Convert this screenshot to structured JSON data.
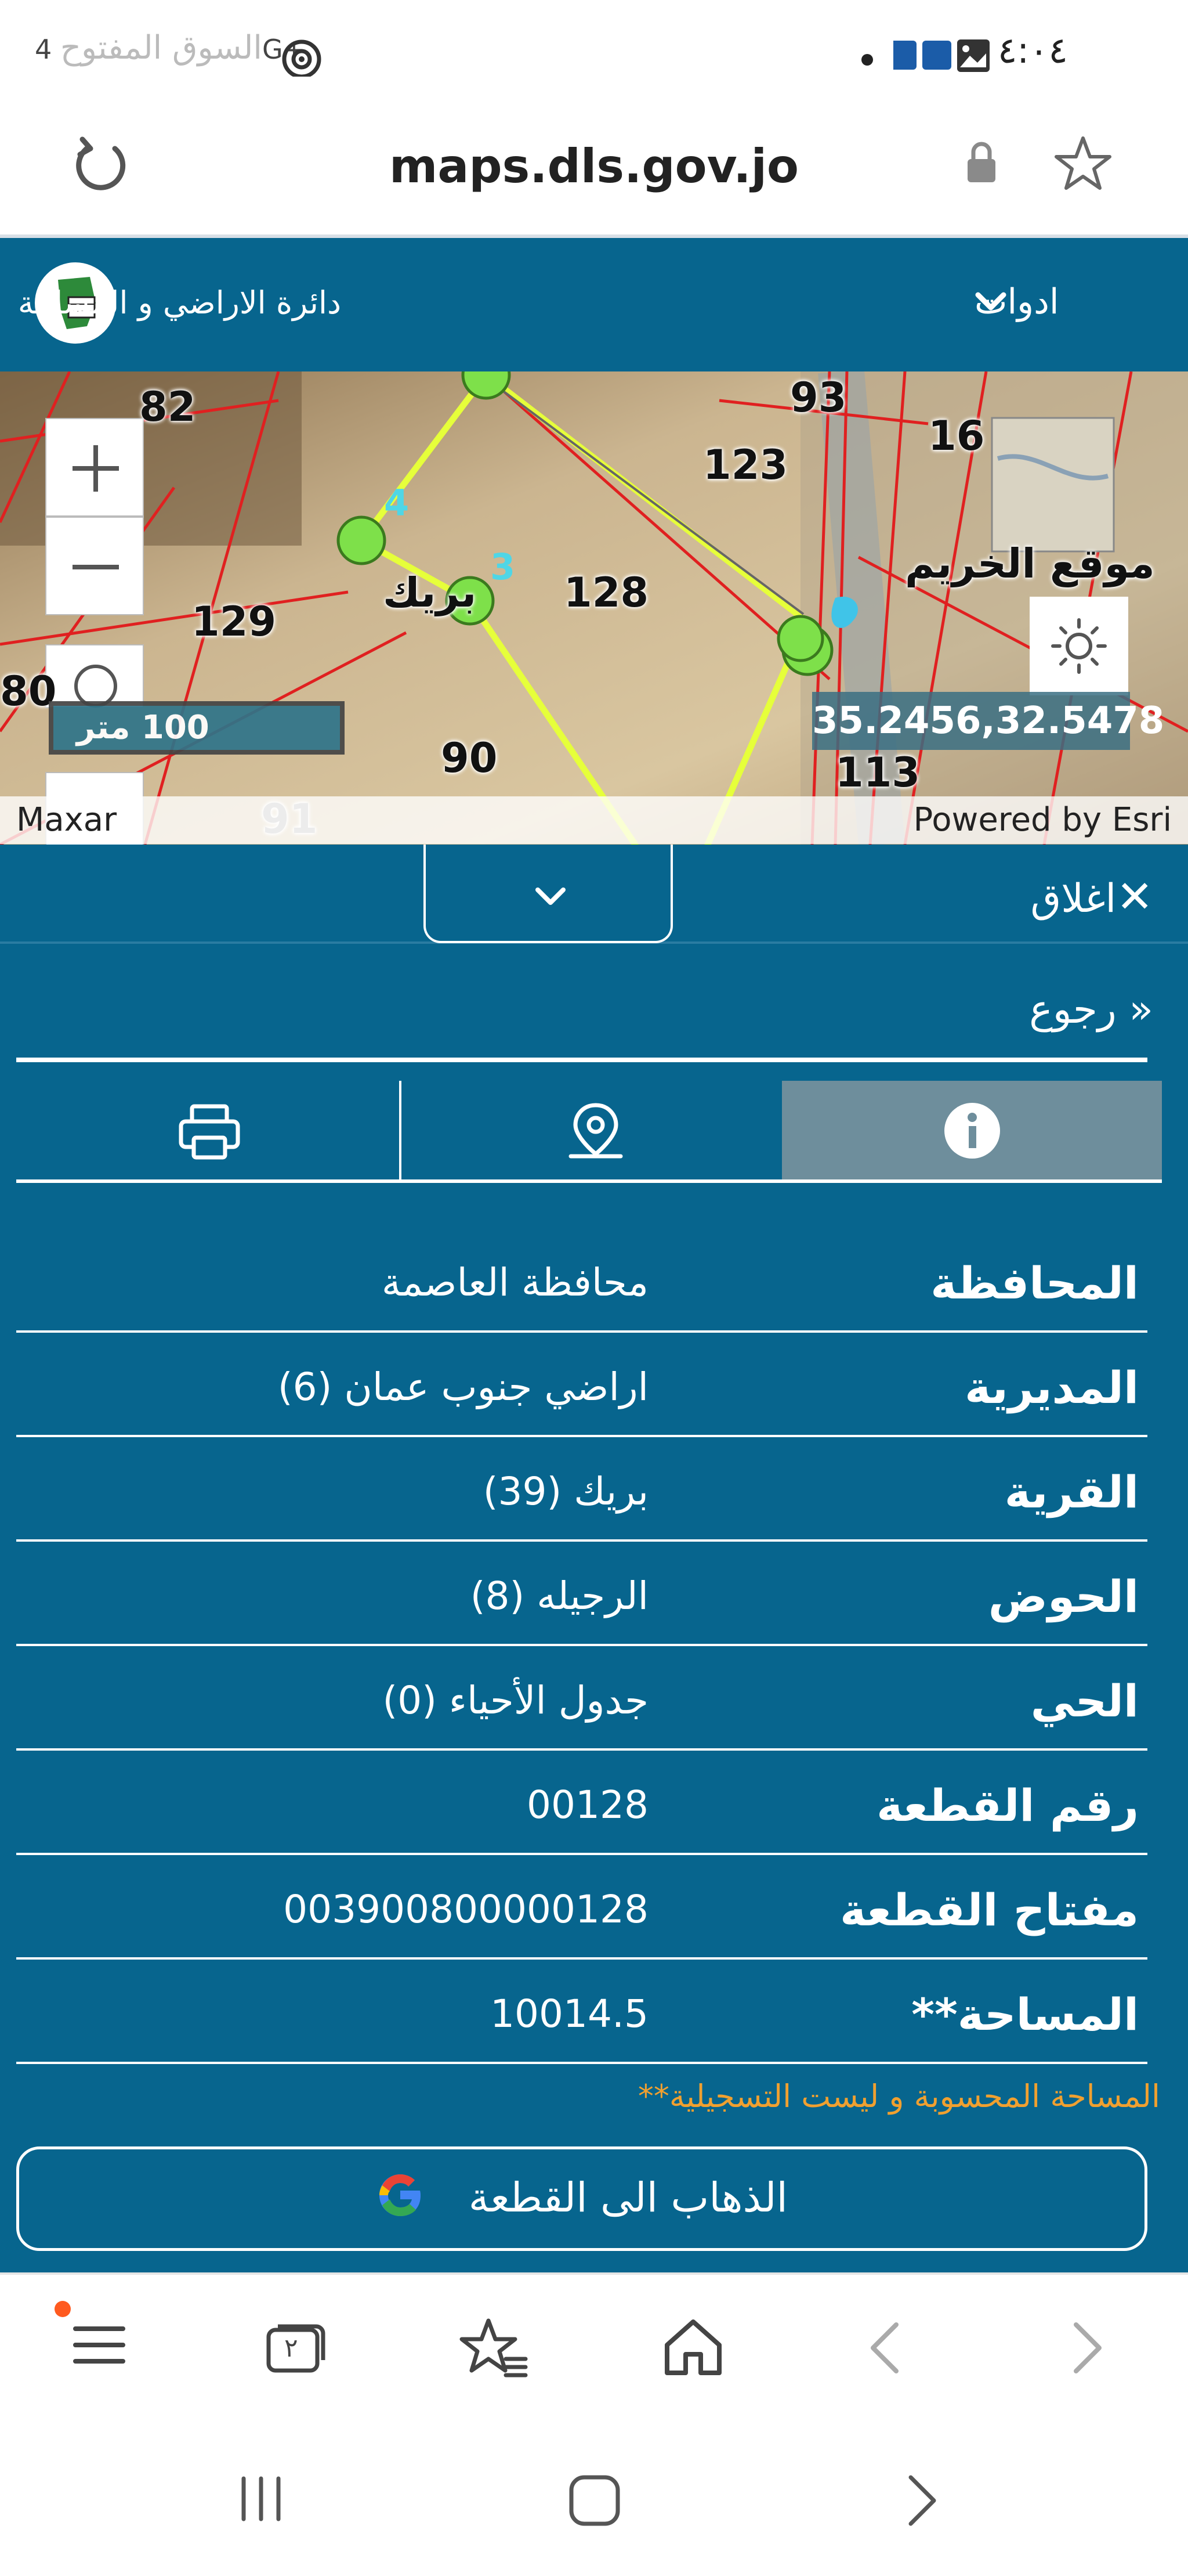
{
  "status_bar": {
    "time": "٤:٠٤",
    "network": "4G+",
    "watermark": "السوق المفتوح"
  },
  "browser": {
    "url": "maps.dls.gov.jo"
  },
  "app": {
    "title": "دائرة الاراضي و المساحة",
    "tools_label": "ادوات"
  },
  "map": {
    "plot_labels": [
      "82",
      "93",
      "16",
      "123",
      "128",
      "129",
      "90",
      "113",
      "91",
      "80"
    ],
    "place_label": "بريك",
    "area_label": "موقع الخريم",
    "vertex_labels": [
      "4",
      "3"
    ],
    "scale_label": "100 متر",
    "coordinates": "35.2456,32.5478",
    "attribution_left": "Maxar",
    "attribution_right": "Powered by Esri"
  },
  "panel": {
    "close_label": "اغلاق",
    "back_label": "رجوع",
    "details": [
      {
        "label": "المحافظة",
        "value": "محافظة العاصمة"
      },
      {
        "label": "المديرية",
        "value": "اراضي جنوب عمان (6)"
      },
      {
        "label": "القرية",
        "value": "بريك (39)"
      },
      {
        "label": "الحوض",
        "value": "الرجيله (8)"
      },
      {
        "label": "الحي",
        "value": "جدول الأحياء (0)"
      },
      {
        "label": "رقم القطعة",
        "value": "00128"
      },
      {
        "label": "مفتاح القطعة",
        "value": "003900800000128"
      },
      {
        "label": "المساحة**",
        "value": "10014.5"
      }
    ],
    "area_note": "المساحة المحسوبة و ليست التسجيلية**",
    "goto_label": "الذهاب الى القطعة"
  },
  "toolbar": {
    "tabs_count": "٢"
  },
  "colors": {
    "primary": "#07658e",
    "active_tab": "#6e8e9c",
    "note": "#f0a030",
    "plot_line": "#e02020",
    "parcel_outline": "#e6ff3a"
  }
}
